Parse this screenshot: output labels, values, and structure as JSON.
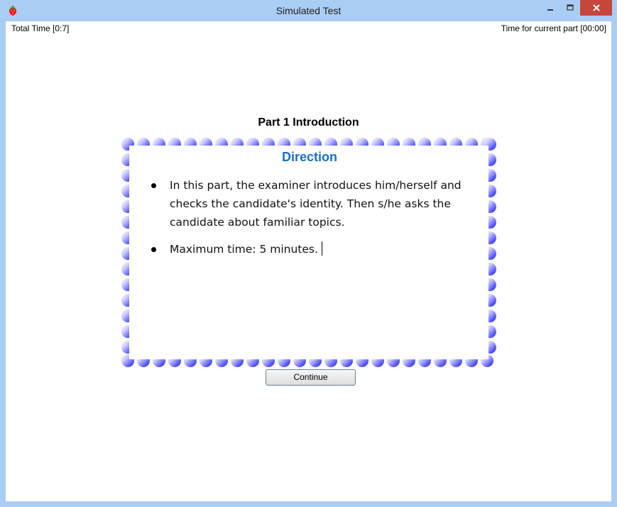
{
  "window": {
    "title": "Simulated Test"
  },
  "timers": {
    "total_time": "Total Time [0:7]",
    "current_part_time": "Time for current part [00:00]"
  },
  "part": {
    "title": "Part 1 Introduction"
  },
  "direction": {
    "heading": "Direction",
    "items": [
      "In this part, the examiner introduces him/herself and checks the candidate's identity. Then s/he asks the candidate about familiar topics.",
      "Maximum time: 5 minutes."
    ]
  },
  "actions": {
    "continue_label": "Continue"
  },
  "colors": {
    "title_bar": "#aacdf3",
    "close_button": "#c7463b",
    "direction_heading": "#1a6fc4",
    "frame_blue": "#1a1aff"
  },
  "icons": {
    "app": "strawberry-icon",
    "minimize": "minimize-icon",
    "maximize": "maximize-icon",
    "close": "close-icon",
    "bullet": "bullet-icon"
  }
}
